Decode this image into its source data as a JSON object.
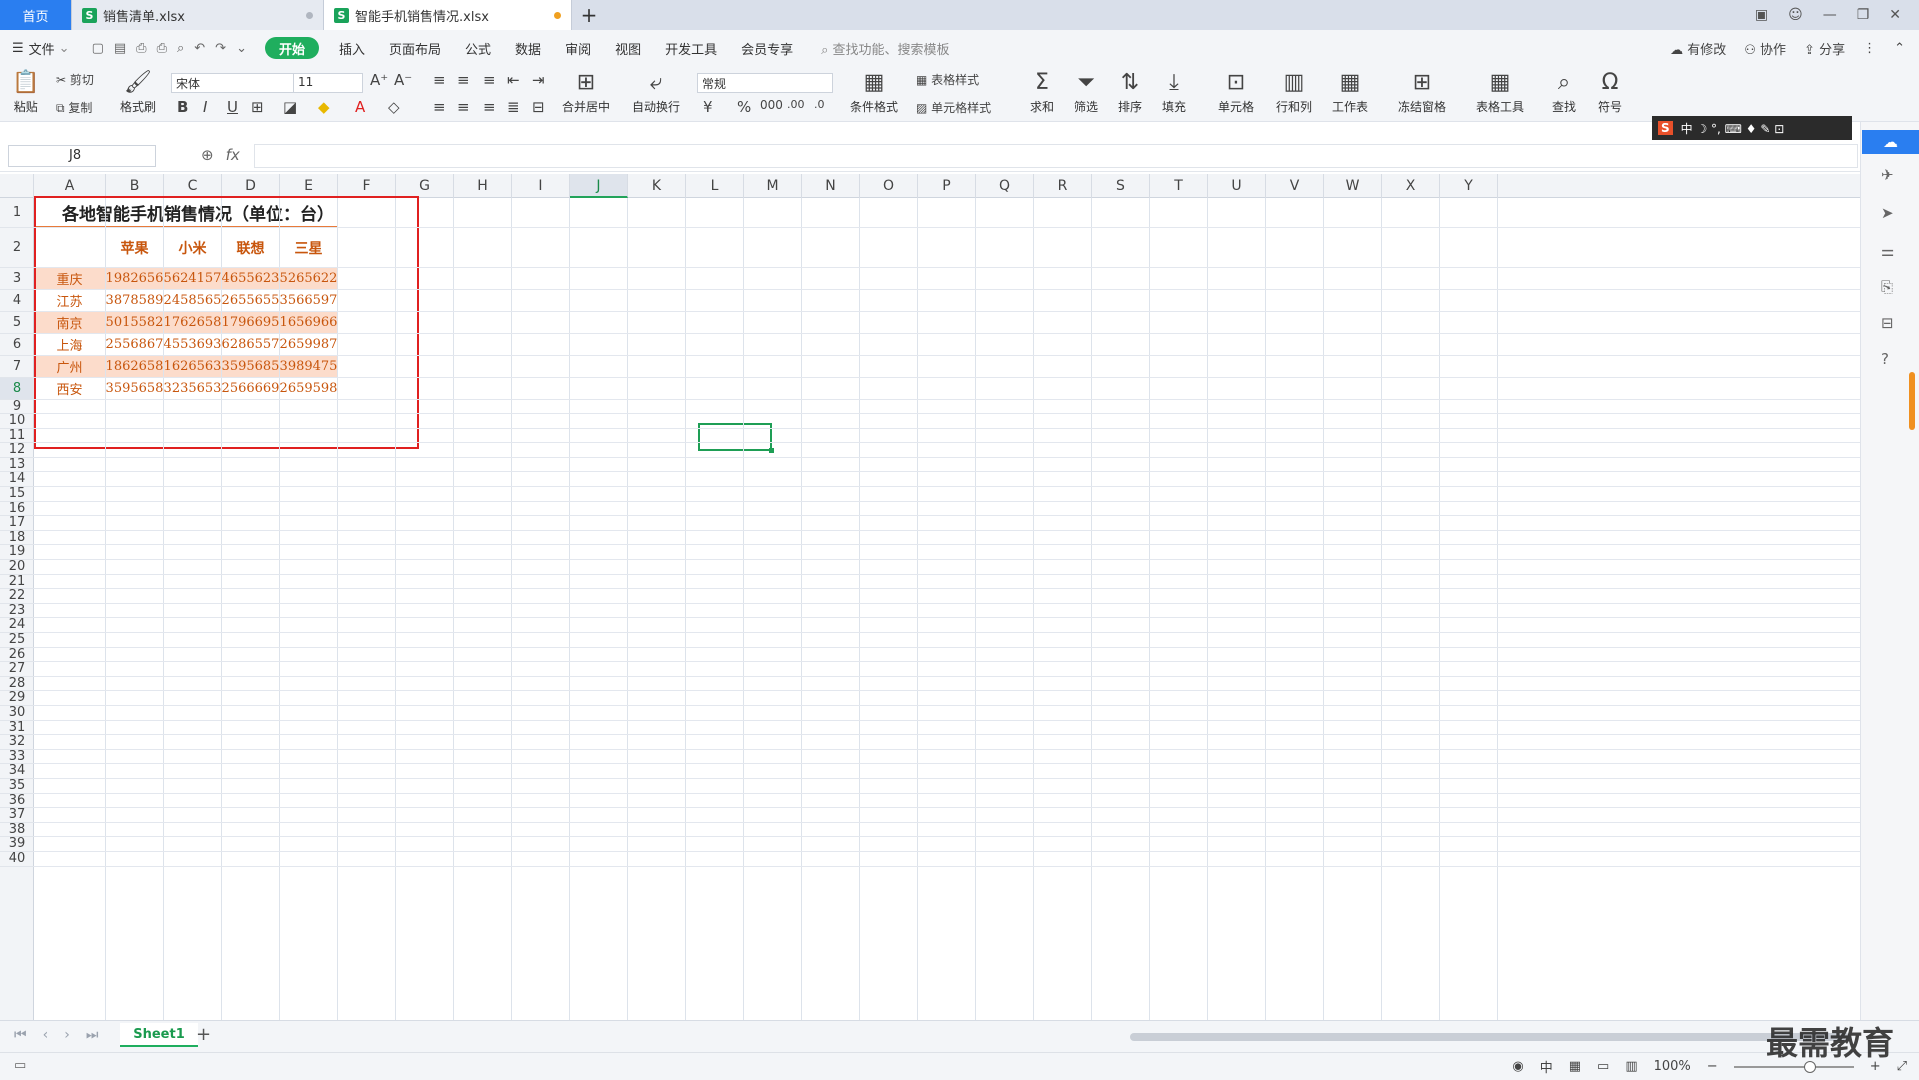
{
  "tabs": [
    {
      "label": "首页"
    },
    {
      "label": "销售清单.xlsx"
    },
    {
      "label": "智能手机销售情况.xlsx"
    }
  ],
  "menu": {
    "file": "文件",
    "items": [
      "开始",
      "插入",
      "页面布局",
      "公式",
      "数据",
      "审阅",
      "视图",
      "开发工具",
      "会员专享"
    ],
    "search": "查找功能、搜索模板",
    "right": [
      "有修改",
      "协作",
      "分享"
    ]
  },
  "ribbon": {
    "paste": "粘贴",
    "cut": "剪切",
    "copy": "复制",
    "format_painter": "格式刷",
    "font": "宋体",
    "size": "11",
    "merge": "合并居中",
    "wrap": "自动换行",
    "number_format": "常规",
    "table_style": "表格样式",
    "cell_style": "单元格样式",
    "cond_format": "条件格式",
    "sum": "求和",
    "filter": "筛选",
    "sort": "排序",
    "fill": "填充",
    "cells": "单元格",
    "rows_cols": "行和列",
    "worksheet": "工作表",
    "freeze": "冻结窗格",
    "table_tools": "表格工具",
    "find": "查找",
    "symbol": "符号"
  },
  "formula_bar": {
    "name_box": "J8",
    "fx": "fx",
    "value": ""
  },
  "columns": [
    "A",
    "B",
    "C",
    "D",
    "E",
    "F",
    "G",
    "H",
    "I",
    "J",
    "K",
    "L",
    "M",
    "N",
    "O",
    "P",
    "Q",
    "R",
    "S",
    "T",
    "U",
    "V",
    "W",
    "X",
    "Y"
  ],
  "rows": [
    "1",
    "2",
    "3",
    "4",
    "5",
    "6",
    "7",
    "8",
    "9",
    "10",
    "11",
    "12",
    "13",
    "14",
    "15",
    "16",
    "17",
    "18",
    "19",
    "20",
    "21",
    "22",
    "23",
    "24",
    "25",
    "26",
    "27",
    "28",
    "29",
    "30",
    "31",
    "32",
    "33",
    "34",
    "35",
    "36",
    "37",
    "38",
    "39",
    "40"
  ],
  "table": {
    "title": "各地智能手机销售情况（单位：台）",
    "headers": [
      "",
      "苹果",
      "小米",
      "联想",
      "三星"
    ],
    "data": [
      [
        "重庆",
        "1982656",
        "5624157",
        "4655623",
        "5265622"
      ],
      [
        "江苏",
        "3878589",
        "2458565",
        "2655655",
        "3566597"
      ],
      [
        "南京",
        "5015582",
        "1762658",
        "1796695",
        "1656966"
      ],
      [
        "上海",
        "2556867",
        "4553693",
        "6286557",
        "2659987"
      ],
      [
        "广州",
        "1862658",
        "1626563",
        "3595685",
        "3989475"
      ],
      [
        "西安",
        "3595658",
        "3235653",
        "2566669",
        "2659598"
      ]
    ]
  },
  "sheet": {
    "name": "Sheet1"
  },
  "status": {
    "zoom": "100%"
  },
  "watermark": "最需教育",
  "colors": {
    "accent": "#1fae5e",
    "data_text": "#c8560d",
    "band": "#fcdccb",
    "highlight_box": "#e02020"
  }
}
